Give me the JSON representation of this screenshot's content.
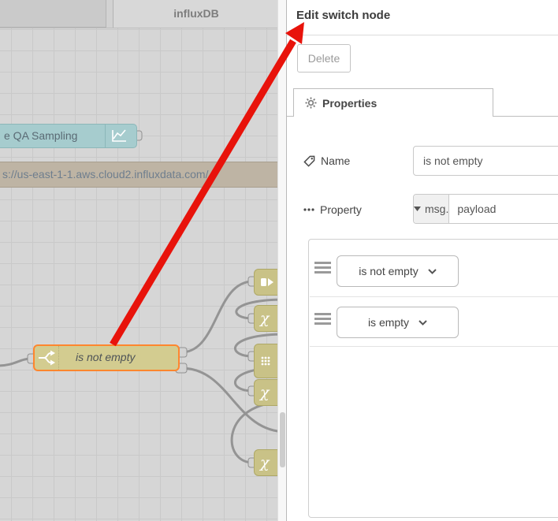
{
  "workspace": {
    "tabs": [
      {
        "label": ""
      },
      {
        "label": "influxDB"
      }
    ],
    "nodes": {
      "qa_sampling": {
        "label": "e QA Sampling"
      },
      "influx_url": {
        "label": "s://us-east-1-1.aws.cloud2.influxdata.com/ t"
      },
      "switch_node": {
        "label": "is not empty"
      },
      "stubs": [
        {
          "icon": "template-icon"
        },
        {
          "icon": "chi-icon"
        },
        {
          "icon": "grid-dots-icon"
        },
        {
          "icon": "chi-icon"
        },
        {
          "icon": "chi-icon"
        }
      ]
    },
    "glyphs": {
      "chi": "χ"
    }
  },
  "editor": {
    "title": "Edit switch node",
    "delete_label": "Delete",
    "properties_tab": "Properties",
    "fields": {
      "name": {
        "label": "Name",
        "value": "is not empty"
      },
      "property": {
        "label": "Property",
        "type_prefix": "msg.",
        "value": "payload"
      }
    },
    "rules": [
      {
        "operator": "is not empty"
      },
      {
        "operator": "is empty"
      }
    ]
  },
  "colors": {
    "switch_fill": "#d3cc90",
    "switch_selected_border": "#ff862e",
    "chart_node_fill": "#a6ccce",
    "influx_node_fill": "#beb4a4",
    "wire": "#949494",
    "annotation_arrow": "#e8130b"
  }
}
